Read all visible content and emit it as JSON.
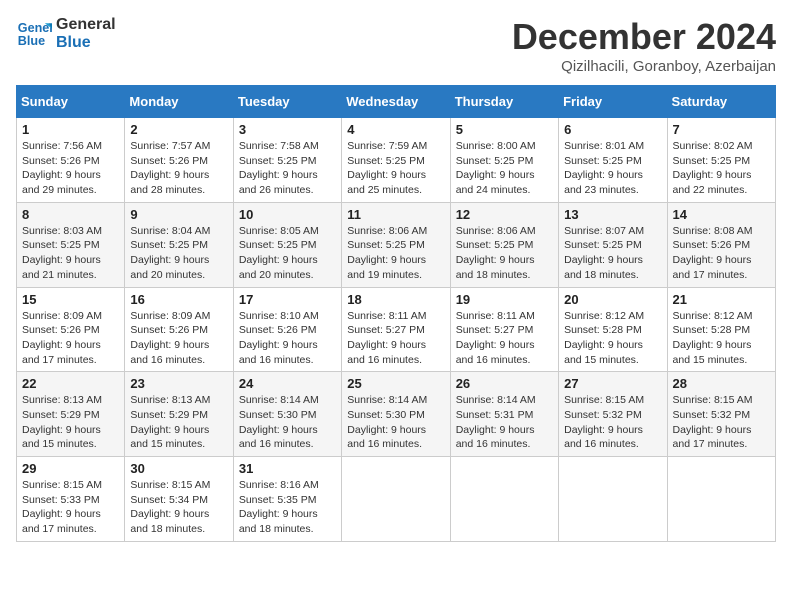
{
  "logo": {
    "line1": "General",
    "line2": "Blue"
  },
  "title": "December 2024",
  "subtitle": "Qizilhacili, Goranboy, Azerbaijan",
  "days_of_week": [
    "Sunday",
    "Monday",
    "Tuesday",
    "Wednesday",
    "Thursday",
    "Friday",
    "Saturday"
  ],
  "weeks": [
    [
      {
        "day": "1",
        "sunrise": "7:56 AM",
        "sunset": "5:26 PM",
        "daylight": "9 hours and 29 minutes."
      },
      {
        "day": "2",
        "sunrise": "7:57 AM",
        "sunset": "5:26 PM",
        "daylight": "9 hours and 28 minutes."
      },
      {
        "day": "3",
        "sunrise": "7:58 AM",
        "sunset": "5:25 PM",
        "daylight": "9 hours and 26 minutes."
      },
      {
        "day": "4",
        "sunrise": "7:59 AM",
        "sunset": "5:25 PM",
        "daylight": "9 hours and 25 minutes."
      },
      {
        "day": "5",
        "sunrise": "8:00 AM",
        "sunset": "5:25 PM",
        "daylight": "9 hours and 24 minutes."
      },
      {
        "day": "6",
        "sunrise": "8:01 AM",
        "sunset": "5:25 PM",
        "daylight": "9 hours and 23 minutes."
      },
      {
        "day": "7",
        "sunrise": "8:02 AM",
        "sunset": "5:25 PM",
        "daylight": "9 hours and 22 minutes."
      }
    ],
    [
      {
        "day": "8",
        "sunrise": "8:03 AM",
        "sunset": "5:25 PM",
        "daylight": "9 hours and 21 minutes."
      },
      {
        "day": "9",
        "sunrise": "8:04 AM",
        "sunset": "5:25 PM",
        "daylight": "9 hours and 20 minutes."
      },
      {
        "day": "10",
        "sunrise": "8:05 AM",
        "sunset": "5:25 PM",
        "daylight": "9 hours and 20 minutes."
      },
      {
        "day": "11",
        "sunrise": "8:06 AM",
        "sunset": "5:25 PM",
        "daylight": "9 hours and 19 minutes."
      },
      {
        "day": "12",
        "sunrise": "8:06 AM",
        "sunset": "5:25 PM",
        "daylight": "9 hours and 18 minutes."
      },
      {
        "day": "13",
        "sunrise": "8:07 AM",
        "sunset": "5:25 PM",
        "daylight": "9 hours and 18 minutes."
      },
      {
        "day": "14",
        "sunrise": "8:08 AM",
        "sunset": "5:26 PM",
        "daylight": "9 hours and 17 minutes."
      }
    ],
    [
      {
        "day": "15",
        "sunrise": "8:09 AM",
        "sunset": "5:26 PM",
        "daylight": "9 hours and 17 minutes."
      },
      {
        "day": "16",
        "sunrise": "8:09 AM",
        "sunset": "5:26 PM",
        "daylight": "9 hours and 16 minutes."
      },
      {
        "day": "17",
        "sunrise": "8:10 AM",
        "sunset": "5:26 PM",
        "daylight": "9 hours and 16 minutes."
      },
      {
        "day": "18",
        "sunrise": "8:11 AM",
        "sunset": "5:27 PM",
        "daylight": "9 hours and 16 minutes."
      },
      {
        "day": "19",
        "sunrise": "8:11 AM",
        "sunset": "5:27 PM",
        "daylight": "9 hours and 16 minutes."
      },
      {
        "day": "20",
        "sunrise": "8:12 AM",
        "sunset": "5:28 PM",
        "daylight": "9 hours and 15 minutes."
      },
      {
        "day": "21",
        "sunrise": "8:12 AM",
        "sunset": "5:28 PM",
        "daylight": "9 hours and 15 minutes."
      }
    ],
    [
      {
        "day": "22",
        "sunrise": "8:13 AM",
        "sunset": "5:29 PM",
        "daylight": "9 hours and 15 minutes."
      },
      {
        "day": "23",
        "sunrise": "8:13 AM",
        "sunset": "5:29 PM",
        "daylight": "9 hours and 15 minutes."
      },
      {
        "day": "24",
        "sunrise": "8:14 AM",
        "sunset": "5:30 PM",
        "daylight": "9 hours and 16 minutes."
      },
      {
        "day": "25",
        "sunrise": "8:14 AM",
        "sunset": "5:30 PM",
        "daylight": "9 hours and 16 minutes."
      },
      {
        "day": "26",
        "sunrise": "8:14 AM",
        "sunset": "5:31 PM",
        "daylight": "9 hours and 16 minutes."
      },
      {
        "day": "27",
        "sunrise": "8:15 AM",
        "sunset": "5:32 PM",
        "daylight": "9 hours and 16 minutes."
      },
      {
        "day": "28",
        "sunrise": "8:15 AM",
        "sunset": "5:32 PM",
        "daylight": "9 hours and 17 minutes."
      }
    ],
    [
      {
        "day": "29",
        "sunrise": "8:15 AM",
        "sunset": "5:33 PM",
        "daylight": "9 hours and 17 minutes."
      },
      {
        "day": "30",
        "sunrise": "8:15 AM",
        "sunset": "5:34 PM",
        "daylight": "9 hours and 18 minutes."
      },
      {
        "day": "31",
        "sunrise": "8:16 AM",
        "sunset": "5:35 PM",
        "daylight": "9 hours and 18 minutes."
      },
      null,
      null,
      null,
      null
    ]
  ]
}
